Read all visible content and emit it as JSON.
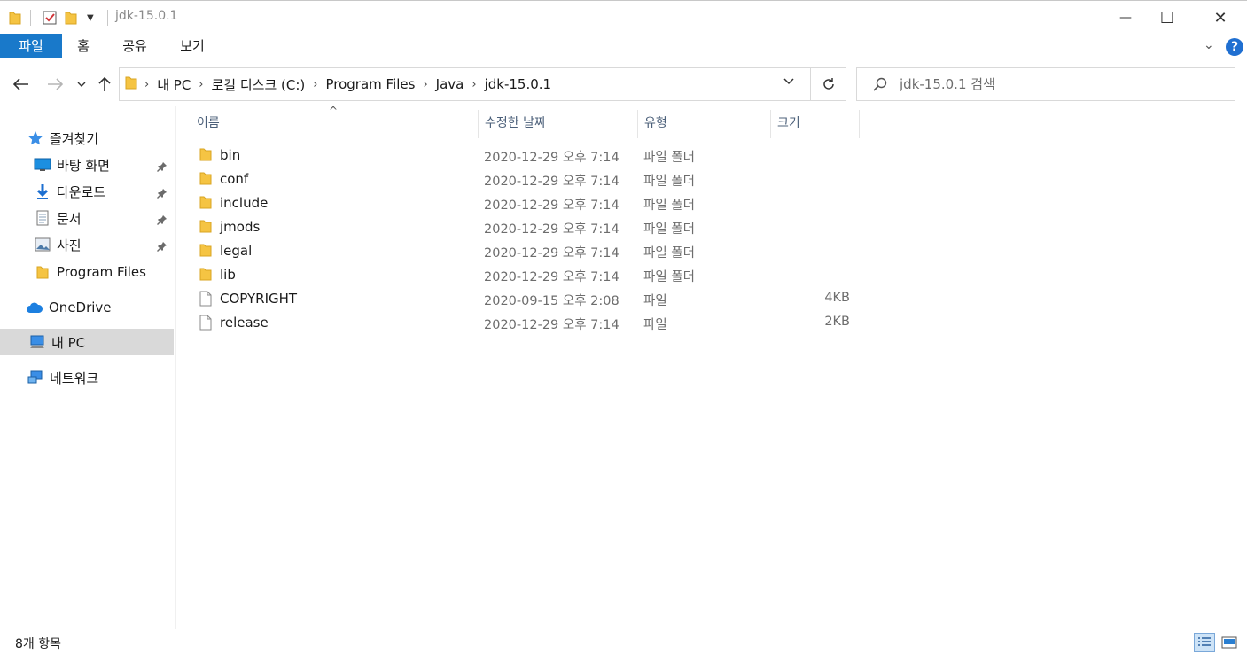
{
  "window": {
    "title": "jdk-15.0.1",
    "minimize_glyph": "—",
    "maximize_glyph": "☐",
    "close_glyph": "✕"
  },
  "ribbon": {
    "tabs": [
      "파일",
      "홈",
      "공유",
      "보기"
    ],
    "help_glyph": "?",
    "expand_glyph": "⌄"
  },
  "nav": {
    "back_icon": "arrow-left-icon",
    "forward_icon": "arrow-right-icon",
    "recent_icon": "chevron-down-icon",
    "up_icon": "arrow-up-icon"
  },
  "address": {
    "crumbs": [
      "내 PC",
      "로컬 디스크 (C:)",
      "Program Files",
      "Java",
      "jdk-15.0.1"
    ]
  },
  "search": {
    "placeholder": "jdk-15.0.1 검색"
  },
  "sidebar": {
    "items": [
      {
        "label": "즐겨찾기",
        "icon": "star-icon",
        "pinned": false
      },
      {
        "label": "바탕 화면",
        "icon": "desktop-icon",
        "pinned": true
      },
      {
        "label": "다운로드",
        "icon": "download-icon",
        "pinned": true
      },
      {
        "label": "문서",
        "icon": "document-icon",
        "pinned": true
      },
      {
        "label": "사진",
        "icon": "pictures-icon",
        "pinned": true
      },
      {
        "label": "Program Files",
        "icon": "folder-icon",
        "pinned": false
      },
      {
        "label": "OneDrive",
        "icon": "cloud-icon",
        "pinned": false
      },
      {
        "label": "내 PC",
        "icon": "computer-icon",
        "pinned": false,
        "selected": true
      },
      {
        "label": "네트워크",
        "icon": "network-icon",
        "pinned": false
      }
    ]
  },
  "columns": {
    "name": "이름",
    "date": "수정한 날짜",
    "type": "유형",
    "size": "크기"
  },
  "files": [
    {
      "name": "bin",
      "date": "2020-12-29 오후 7:14",
      "type": "파일 폴더",
      "size": "",
      "kind": "folder"
    },
    {
      "name": "conf",
      "date": "2020-12-29 오후 7:14",
      "type": "파일 폴더",
      "size": "",
      "kind": "folder"
    },
    {
      "name": "include",
      "date": "2020-12-29 오후 7:14",
      "type": "파일 폴더",
      "size": "",
      "kind": "folder"
    },
    {
      "name": "jmods",
      "date": "2020-12-29 오후 7:14",
      "type": "파일 폴더",
      "size": "",
      "kind": "folder"
    },
    {
      "name": "legal",
      "date": "2020-12-29 오후 7:14",
      "type": "파일 폴더",
      "size": "",
      "kind": "folder"
    },
    {
      "name": "lib",
      "date": "2020-12-29 오후 7:14",
      "type": "파일 폴더",
      "size": "",
      "kind": "folder"
    },
    {
      "name": "COPYRIGHT",
      "date": "2020-09-15 오후 2:08",
      "type": "파일",
      "size": "4KB",
      "kind": "file"
    },
    {
      "name": "release",
      "date": "2020-12-29 오후 7:14",
      "type": "파일",
      "size": "2KB",
      "kind": "file"
    }
  ],
  "status": {
    "item_count": "8개 항목"
  },
  "colors": {
    "accent": "#1979ca",
    "folder": "#f5c443",
    "selected_bg": "#d9d9d9",
    "header_text": "#4c607a"
  }
}
